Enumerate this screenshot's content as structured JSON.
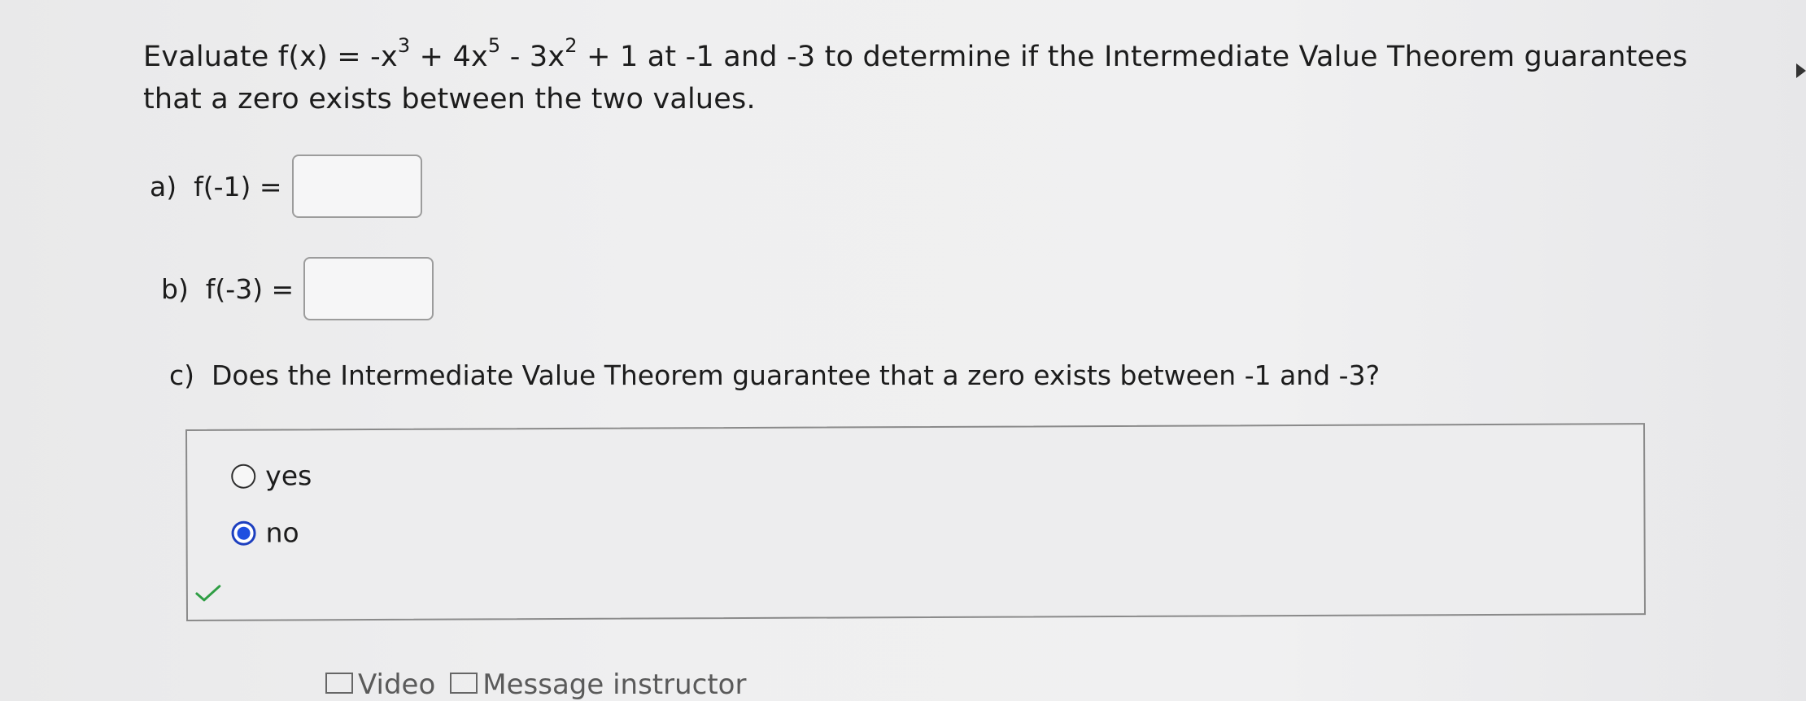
{
  "question": {
    "prefix": "Evaluate f(x) = -x",
    "exp1": "3",
    "mid1": " + 4x",
    "exp2": "5",
    "mid2": " - 3x",
    "exp3": "2",
    "suffix": " + 1 at -1 and -3 to determine if the Intermediate Value Theorem guarantees that a zero exists between the two values."
  },
  "parts": {
    "a": {
      "label": "a)  f(-1) =",
      "value": ""
    },
    "b": {
      "label": "b)  f(-3) =",
      "value": ""
    },
    "c": {
      "label": "c)  Does the Intermediate Value Theorem guarantee that a zero exists between -1 and -3?"
    }
  },
  "choices": {
    "options": [
      {
        "label": "yes",
        "selected": false
      },
      {
        "label": "no",
        "selected": true
      }
    ]
  },
  "status": {
    "correct_icon": "checkmark-icon",
    "color": "#2f9e44"
  },
  "footer": {
    "links": [
      "Video",
      "Message instructor"
    ]
  }
}
